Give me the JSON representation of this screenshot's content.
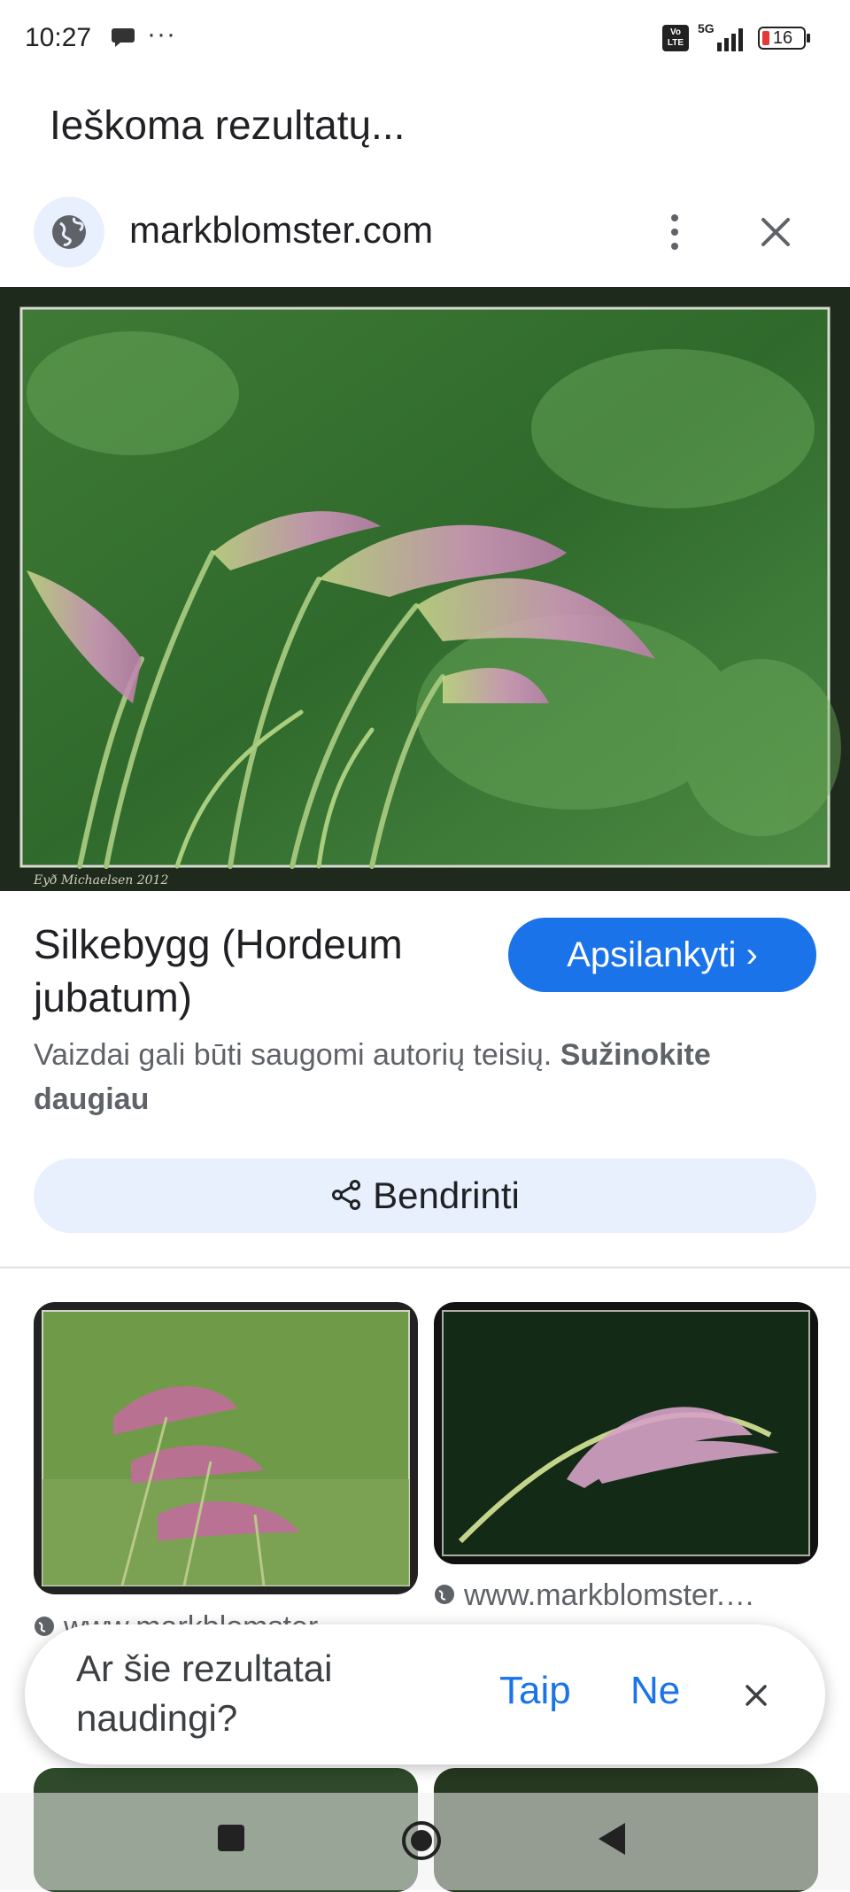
{
  "status_bar": {
    "time": "10:27",
    "more": "···",
    "volte": "Vo LTE",
    "network": "5G",
    "battery": "16"
  },
  "search": {
    "status": "Ieškoma rezultatų..."
  },
  "source": {
    "site": "markblomster.com"
  },
  "hero": {
    "credit": "Eyð Michaelsen 2012"
  },
  "result": {
    "title": "Silkebygg (Hordeum jubatum)",
    "visit_label": "Apsilankyti ›",
    "copyright_text": "Vaizdai gali būti saugomi autorių teisių.",
    "learn_more": "Sužinokite daugiau",
    "share_label": "Bendrinti"
  },
  "related": {
    "items": [
      {
        "source": "www.markblomster.…"
      },
      {
        "source": "www.markblomster.…"
      }
    ]
  },
  "feedback": {
    "question": "Ar šie rezultatai naudingi?",
    "yes": "Taip",
    "no": "Ne"
  },
  "colors": {
    "accent": "#1a73e8",
    "chip_bg": "#e8f0fe",
    "secondary_text": "#5f6368"
  }
}
